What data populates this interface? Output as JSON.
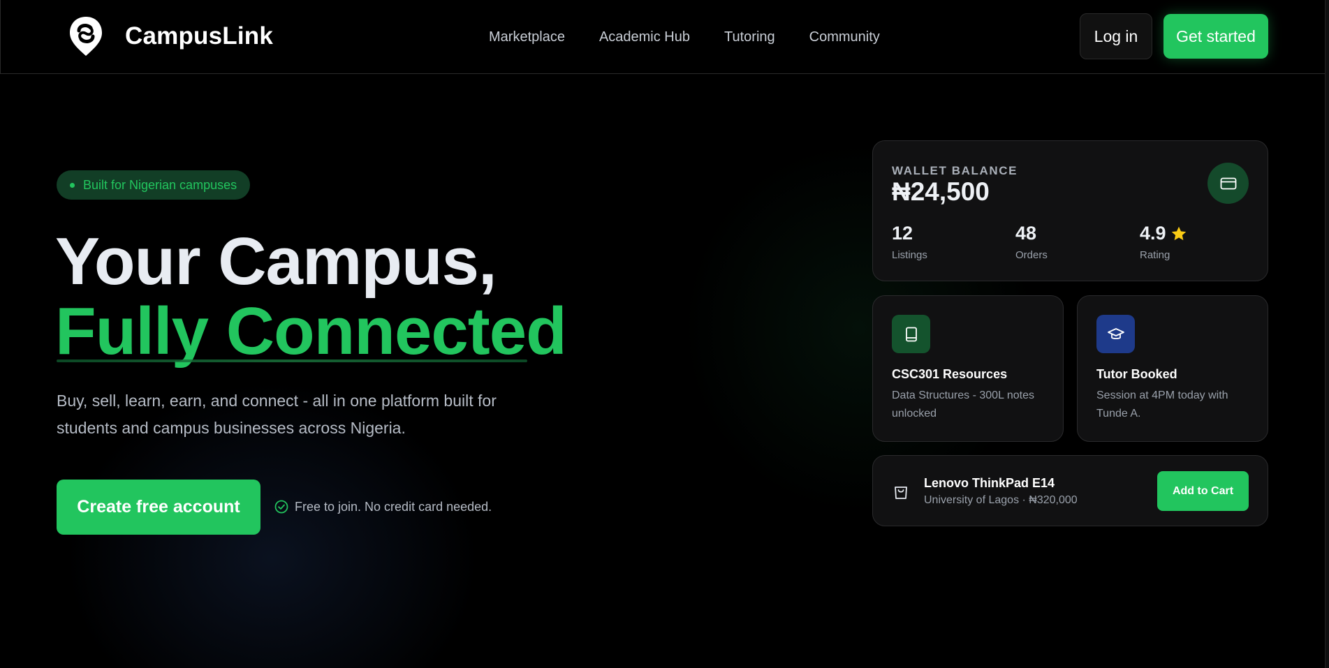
{
  "header": {
    "brand_name": "CampusLink",
    "nav": [
      "Marketplace",
      "Academic Hub",
      "Tutoring",
      "Community"
    ],
    "login_label": "Log in",
    "get_started_label": "Get started"
  },
  "hero": {
    "badge": "Built for Nigerian campuses",
    "title_line1": "Your Campus,",
    "title_line2": "Fully Connected",
    "subtitle": "Buy, sell, learn, earn, and connect - all in one platform built for students and campus businesses across Nigeria.",
    "cta_label": "Create free account",
    "cta_note": "Free to join. No credit card needed."
  },
  "wallet": {
    "label": "WALLET BALANCE",
    "amount": "₦24,500",
    "icon": "credit-card-icon",
    "stats": [
      {
        "value": "12",
        "label": "Listings"
      },
      {
        "value": "48",
        "label": "Orders"
      },
      {
        "value": "4.9",
        "label": "Rating",
        "icon": "star-icon"
      }
    ]
  },
  "features": [
    {
      "title": "CSC301 Resources",
      "desc": "Data Structures - 300L notes unlocked",
      "icon": "book-icon",
      "icon_bg": "#14532d"
    },
    {
      "title": "Tutor Booked",
      "desc": "Session at 4PM today with Tunde A.",
      "icon": "graduation-cap-icon",
      "icon_bg": "#1e3a8a"
    }
  ],
  "product": {
    "name": "Lenovo ThinkPad E14",
    "meta": "University of Lagos · ₦320,000",
    "icon": "shopping-bag-icon",
    "cart_label": "Add to Cart"
  },
  "colors": {
    "accent": "#22c55e",
    "background": "#000000",
    "card": "#111112",
    "star": "#facc15"
  }
}
